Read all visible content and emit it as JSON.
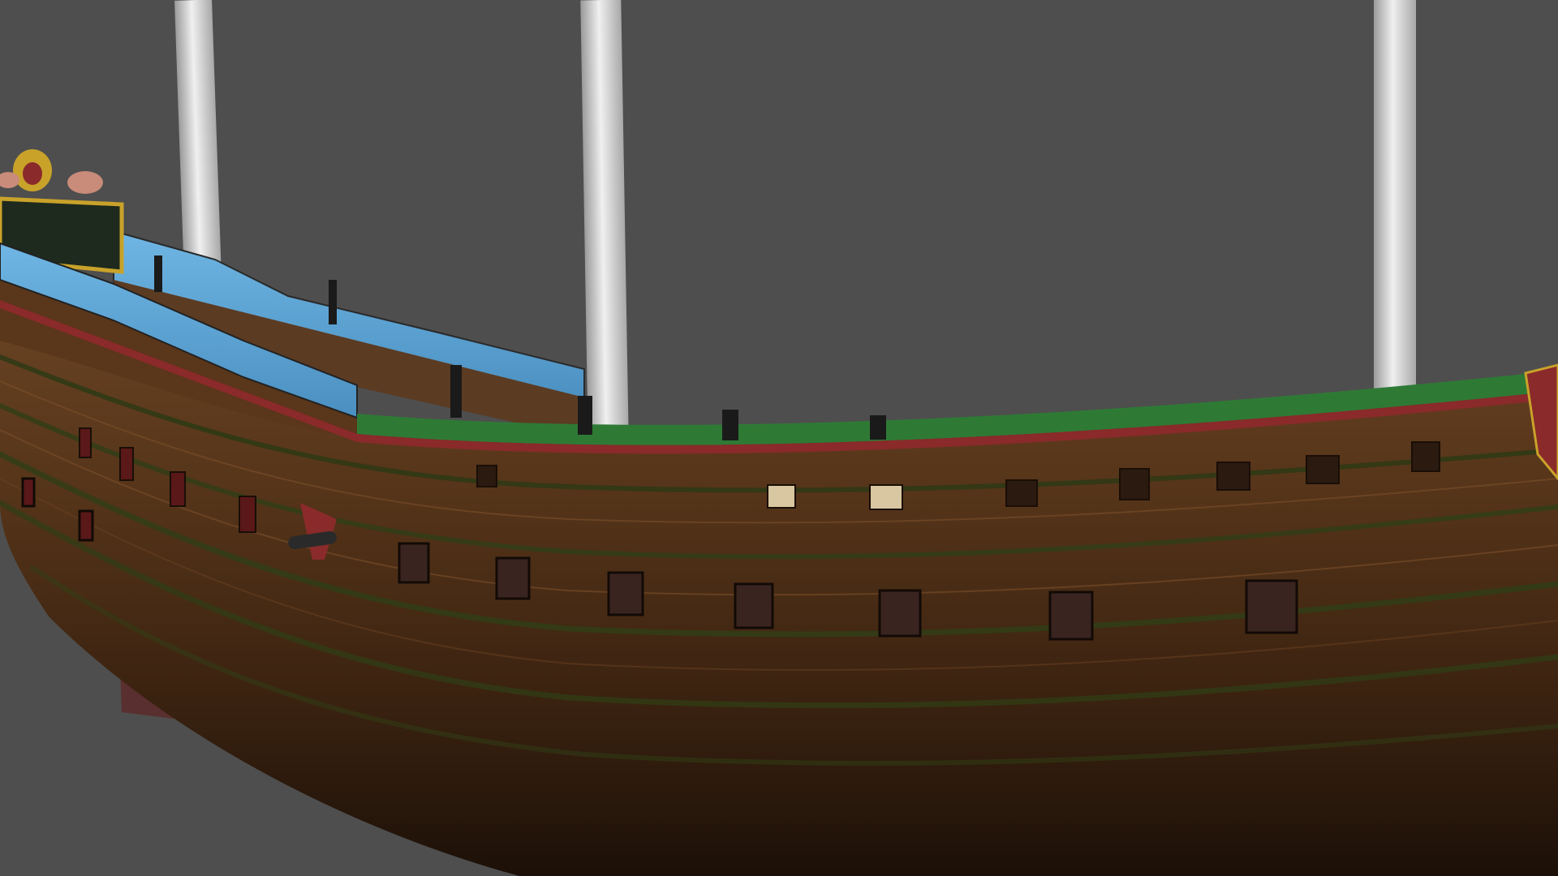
{
  "scene": {
    "background_color": "#4e4e4e",
    "subject": "galleon-hull-3d-render",
    "colors": {
      "hull_wood": "#4a2b16",
      "hull_wood_light": "#6b4424",
      "hull_wood_dark": "#2a170b",
      "keel": "#5a2f2f",
      "rail_green": "#2e7a35",
      "rail_red": "#8a2a2a",
      "bulwark_blue": "#5fa8d8",
      "mast": "#cfcfcf",
      "port_lid": "#3a2420",
      "gold": "#c9a22a"
    },
    "mast_count": 3,
    "upper_gunport_count": 12,
    "lower_gunport_count": 11
  }
}
